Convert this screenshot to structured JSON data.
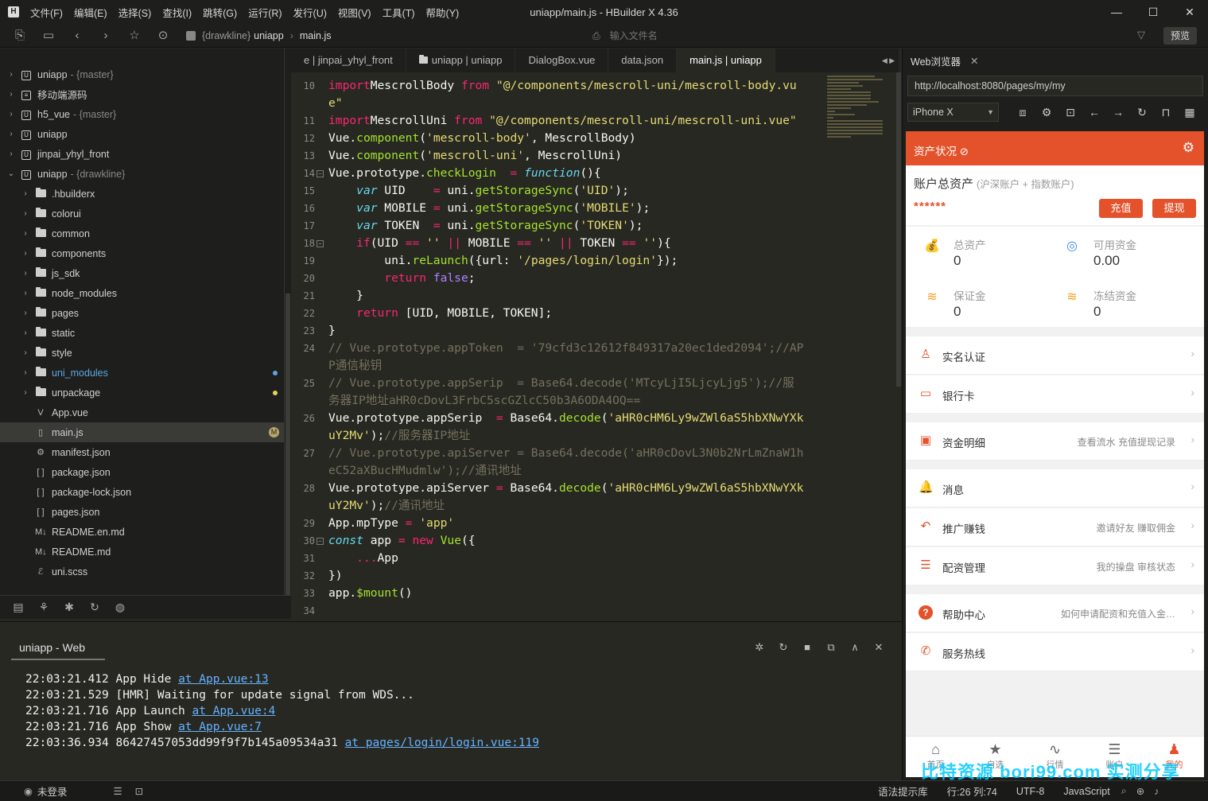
{
  "window": {
    "logo": "H",
    "title": "uniapp/main.js - HBuilder X 4.36",
    "menu": [
      "文件(F)",
      "编辑(E)",
      "选择(S)",
      "查找(I)",
      "跳转(G)",
      "运行(R)",
      "发行(U)",
      "视图(V)",
      "工具(T)",
      "帮助(Y)"
    ],
    "controls": {
      "minimize": "—",
      "maximize": "☐",
      "close": "✕"
    }
  },
  "toolbar": {
    "breadcrumb": [
      "{drawkline}",
      "uniapp",
      "main.js"
    ],
    "file_search_placeholder": "输入文件名",
    "preview_label": "预览"
  },
  "sidebar": {
    "items": [
      {
        "label": "uniapp",
        "branch": "- {master}",
        "type": "project",
        "expanded": false,
        "depth": 0
      },
      {
        "label": "移动端源码",
        "branch": "",
        "type": "project-alt",
        "expanded": false,
        "depth": 0
      },
      {
        "label": "h5_vue",
        "branch": "- {master}",
        "type": "project",
        "expanded": false,
        "depth": 0
      },
      {
        "label": "uniapp",
        "branch": "",
        "type": "project",
        "expanded": false,
        "depth": 0
      },
      {
        "label": "jinpai_yhyl_front",
        "branch": "",
        "type": "project",
        "expanded": false,
        "depth": 0
      },
      {
        "label": "uniapp",
        "branch": "- {drawkline}",
        "type": "project",
        "expanded": true,
        "depth": 0
      },
      {
        "label": ".hbuilderx",
        "type": "folder",
        "depth": 1
      },
      {
        "label": "colorui",
        "type": "folder",
        "depth": 1
      },
      {
        "label": "common",
        "type": "folder",
        "depth": 1
      },
      {
        "label": "components",
        "type": "folder",
        "depth": 1
      },
      {
        "label": "js_sdk",
        "type": "folder",
        "depth": 1
      },
      {
        "label": "node_modules",
        "type": "folder",
        "depth": 1
      },
      {
        "label": "pages",
        "type": "folder",
        "depth": 1
      },
      {
        "label": "static",
        "type": "folder",
        "depth": 1
      },
      {
        "label": "style",
        "type": "folder",
        "depth": 1
      },
      {
        "label": "uni_modules",
        "type": "folder",
        "depth": 1,
        "dot": "#5aa7e6",
        "highlight": true
      },
      {
        "label": "unpackage",
        "type": "folder",
        "depth": 1,
        "dot": "#e6d35a"
      },
      {
        "label": "App.vue",
        "type": "vue",
        "depth": 1
      },
      {
        "label": "main.js",
        "type": "js",
        "depth": 1,
        "selected": true,
        "badge": "M"
      },
      {
        "label": "manifest.json",
        "type": "manifest",
        "depth": 1
      },
      {
        "label": "package.json",
        "type": "json",
        "depth": 1
      },
      {
        "label": "package-lock.json",
        "type": "json",
        "depth": 1
      },
      {
        "label": "pages.json",
        "type": "json",
        "depth": 1
      },
      {
        "label": "README.en.md",
        "type": "md",
        "depth": 1
      },
      {
        "label": "README.md",
        "type": "md",
        "depth": 1
      },
      {
        "label": "uni.scss",
        "type": "scss",
        "depth": 1
      }
    ]
  },
  "editor": {
    "tabs": [
      {
        "label": "e | jinpai_yhyl_front",
        "active": false
      },
      {
        "label": "uniapp | uniapp",
        "active": false,
        "folder": true
      },
      {
        "label": "DialogBox.vue",
        "active": false
      },
      {
        "label": "data.json",
        "active": false
      },
      {
        "label": "main.js | uniapp",
        "active": true
      }
    ],
    "lines": [
      {
        "n": "10",
        "fold": false,
        "segs": [
          [
            "kw",
            "import"
          ],
          [
            "",
            "MescrollBody "
          ],
          [
            "kw",
            "from"
          ],
          [
            "",
            " "
          ],
          [
            "str",
            "\"@/components/mescroll-uni/mescroll-body.vu"
          ]
        ]
      },
      {
        "n": "",
        "fold": false,
        "segs": [
          [
            "str",
            "e\""
          ]
        ]
      },
      {
        "n": "11",
        "fold": false,
        "segs": [
          [
            "kw",
            "import"
          ],
          [
            "",
            "MescrollUni "
          ],
          [
            "kw",
            "from"
          ],
          [
            "",
            " "
          ],
          [
            "str",
            "\"@/components/mescroll-uni/mescroll-uni.vue\""
          ]
        ]
      },
      {
        "n": "12",
        "fold": false,
        "segs": [
          [
            "",
            "Vue."
          ],
          [
            "fn",
            "component"
          ],
          [
            "",
            "("
          ],
          [
            "str",
            "'mescroll-body'"
          ],
          [
            "",
            ", MescrollBody)"
          ]
        ]
      },
      {
        "n": "13",
        "fold": false,
        "segs": [
          [
            "",
            "Vue."
          ],
          [
            "fn",
            "component"
          ],
          [
            "",
            "("
          ],
          [
            "str",
            "'mescroll-uni'"
          ],
          [
            "",
            ", MescrollUni)"
          ]
        ]
      },
      {
        "n": "14",
        "fold": true,
        "segs": [
          [
            "",
            "Vue.prototype."
          ],
          [
            "fn",
            "checkLogin"
          ],
          [
            "",
            "  "
          ],
          [
            "kw",
            "="
          ],
          [
            "",
            " "
          ],
          [
            "it",
            "function"
          ],
          [
            "",
            "(){"
          ]
        ]
      },
      {
        "n": "15",
        "fold": false,
        "segs": [
          [
            "",
            "    "
          ],
          [
            "vr",
            "var"
          ],
          [
            "",
            " UID    "
          ],
          [
            "kw",
            "="
          ],
          [
            "",
            " uni."
          ],
          [
            "fn",
            "getStorageSync"
          ],
          [
            "",
            "("
          ],
          [
            "str",
            "'UID'"
          ],
          [
            "",
            ");"
          ]
        ]
      },
      {
        "n": "16",
        "fold": false,
        "segs": [
          [
            "",
            "    "
          ],
          [
            "vr",
            "var"
          ],
          [
            "",
            " MOBILE "
          ],
          [
            "kw",
            "="
          ],
          [
            "",
            " uni."
          ],
          [
            "fn",
            "getStorageSync"
          ],
          [
            "",
            "("
          ],
          [
            "str",
            "'MOBILE'"
          ],
          [
            "",
            ");"
          ]
        ]
      },
      {
        "n": "17",
        "fold": false,
        "segs": [
          [
            "",
            "    "
          ],
          [
            "vr",
            "var"
          ],
          [
            "",
            " TOKEN  "
          ],
          [
            "kw",
            "="
          ],
          [
            "",
            " uni."
          ],
          [
            "fn",
            "getStorageSync"
          ],
          [
            "",
            "("
          ],
          [
            "str",
            "'TOKEN'"
          ],
          [
            "",
            ");"
          ]
        ]
      },
      {
        "n": "18",
        "fold": true,
        "segs": [
          [
            "",
            "    "
          ],
          [
            "kw",
            "if"
          ],
          [
            "",
            "(UID "
          ],
          [
            "kw",
            "=="
          ],
          [
            "",
            " "
          ],
          [
            "str",
            "''"
          ],
          [
            "",
            " "
          ],
          [
            "kw",
            "||"
          ],
          [
            "",
            " MOBILE "
          ],
          [
            "kw",
            "=="
          ],
          [
            "",
            " "
          ],
          [
            "str",
            "''"
          ],
          [
            "",
            " "
          ],
          [
            "kw",
            "||"
          ],
          [
            "",
            " TOKEN "
          ],
          [
            "kw",
            "=="
          ],
          [
            "",
            " "
          ],
          [
            "str",
            "''"
          ],
          [
            "",
            "){"
          ]
        ]
      },
      {
        "n": "19",
        "fold": false,
        "segs": [
          [
            "",
            "        uni."
          ],
          [
            "fn",
            "reLaunch"
          ],
          [
            "",
            "({url: "
          ],
          [
            "str",
            "'/pages/login/login'"
          ],
          [
            "",
            "});"
          ]
        ]
      },
      {
        "n": "20",
        "fold": false,
        "segs": [
          [
            "",
            "        "
          ],
          [
            "kw",
            "return"
          ],
          [
            "",
            " "
          ],
          [
            "bl",
            "false"
          ],
          [
            "",
            ";"
          ]
        ]
      },
      {
        "n": "21",
        "fold": false,
        "segs": [
          [
            "",
            "    }"
          ]
        ]
      },
      {
        "n": "22",
        "fold": false,
        "segs": [
          [
            "",
            "    "
          ],
          [
            "kw",
            "return"
          ],
          [
            "",
            " [UID, MOBILE, TOKEN];"
          ]
        ]
      },
      {
        "n": "23",
        "fold": false,
        "segs": [
          [
            "",
            "}"
          ]
        ]
      },
      {
        "n": "24",
        "fold": false,
        "segs": [
          [
            "cm",
            "// Vue.prototype.appToken  = '79cfd3c12612f849317a20ec1ded2094';//AP"
          ]
        ]
      },
      {
        "n": "",
        "fold": false,
        "segs": [
          [
            "cm",
            "P通信秘钥"
          ]
        ]
      },
      {
        "n": "25",
        "fold": false,
        "segs": [
          [
            "cm",
            "// Vue.prototype.appSerip  = Base64.decode('MTcyLjI5LjcyLjg5');//服"
          ]
        ]
      },
      {
        "n": "",
        "fold": false,
        "segs": [
          [
            "cm",
            "务器IP地址aHR0cDovL3FrbC5scGZlcC50b3A6ODA4OQ=="
          ]
        ]
      },
      {
        "n": "26",
        "fold": false,
        "segs": [
          [
            "",
            "Vue.prototype.appSerip  "
          ],
          [
            "kw",
            "="
          ],
          [
            "",
            " Base64."
          ],
          [
            "fn",
            "decode"
          ],
          [
            "",
            "("
          ],
          [
            "str",
            "'aHR0cHM6Ly9wZWl6aS5hbXNwYXk"
          ]
        ]
      },
      {
        "n": "",
        "fold": false,
        "segs": [
          [
            "str",
            "uY2Mv'"
          ],
          [
            "",
            ");"
          ],
          [
            "cm",
            "//服务器IP地址"
          ]
        ]
      },
      {
        "n": "27",
        "fold": false,
        "segs": [
          [
            "cm",
            "// Vue.prototype.apiServer = Base64.decode('aHR0cDovL3N0b2NrLmZnaW1h"
          ]
        ]
      },
      {
        "n": "",
        "fold": false,
        "segs": [
          [
            "cm",
            "eC52aXBucHMudmlw');//通讯地址"
          ]
        ]
      },
      {
        "n": "28",
        "fold": false,
        "segs": [
          [
            "",
            "Vue.prototype.apiServer "
          ],
          [
            "kw",
            "="
          ],
          [
            "",
            " Base64."
          ],
          [
            "fn",
            "decode"
          ],
          [
            "",
            "("
          ],
          [
            "str",
            "'aHR0cHM6Ly9wZWl6aS5hbXNwYXk"
          ]
        ]
      },
      {
        "n": "",
        "fold": false,
        "segs": [
          [
            "str",
            "uY2Mv'"
          ],
          [
            "",
            ");"
          ],
          [
            "cm",
            "//通讯地址"
          ]
        ]
      },
      {
        "n": "29",
        "fold": false,
        "segs": [
          [
            "",
            "App.mpType "
          ],
          [
            "kw",
            "="
          ],
          [
            "",
            " "
          ],
          [
            "str",
            "'app'"
          ]
        ]
      },
      {
        "n": "30",
        "fold": true,
        "segs": [
          [
            "it",
            "const"
          ],
          [
            "",
            " app "
          ],
          [
            "kw",
            "="
          ],
          [
            "",
            " "
          ],
          [
            "kw",
            "new"
          ],
          [
            "",
            " "
          ],
          [
            "fn",
            "Vue"
          ],
          [
            "",
            "({"
          ]
        ]
      },
      {
        "n": "31",
        "fold": false,
        "segs": [
          [
            "",
            "    "
          ],
          [
            "kw",
            "..."
          ],
          [
            "",
            "App"
          ]
        ]
      },
      {
        "n": "32",
        "fold": false,
        "segs": [
          [
            "",
            "})"
          ]
        ]
      },
      {
        "n": "33",
        "fold": false,
        "segs": [
          [
            "",
            "app."
          ],
          [
            "fn",
            "$mount"
          ],
          [
            "",
            "()"
          ]
        ]
      },
      {
        "n": "34",
        "fold": false,
        "segs": [
          [
            "",
            ""
          ]
        ]
      }
    ]
  },
  "console": {
    "title": "uniapp - Web",
    "logs": [
      {
        "text": "22:03:21.412 App Hide ",
        "link": "at App.vue:13"
      },
      {
        "text": "22:03:21.529 [HMR] Waiting for update signal from WDS...",
        "link": ""
      },
      {
        "text": "22:03:21.716 App Launch ",
        "link": "at App.vue:4"
      },
      {
        "text": "22:03:21.716 App Show ",
        "link": "at App.vue:7"
      },
      {
        "text": "22:03:36.934 86427457053dd99f9f7b145a09534a31 ",
        "link": "at pages/login/login.vue:119"
      }
    ]
  },
  "statusbar": {
    "login": "未登录",
    "syntax_hint": "语法提示库",
    "position": "行:26  列:74",
    "encoding": "UTF-8",
    "language": "JavaScript"
  },
  "browser": {
    "tab_label": "Web浏览器",
    "url": "http://localhost:8080/pages/my/my",
    "device": "iPhone X"
  },
  "phone": {
    "header_title": "资产状况",
    "account_title": "账户总资产",
    "account_sub": "(沪深账户 + 指数账户)",
    "masked": "******",
    "recharge": "充值",
    "withdraw": "提现",
    "stats": [
      {
        "label": "总资产",
        "value": "0",
        "icon": "money-bag-icon"
      },
      {
        "label": "可用资金",
        "value": "0.00",
        "icon": "target-icon"
      },
      {
        "label": "保证金",
        "value": "0",
        "icon": "coins-icon"
      },
      {
        "label": "冻结资金",
        "value": "0",
        "icon": "coins-frozen-icon"
      }
    ],
    "menu": [
      {
        "label": "实名认证",
        "right": "",
        "icon": "user-icon",
        "color": "#e4522b"
      },
      {
        "label": "银行卡",
        "right": "",
        "icon": "card-icon",
        "color": "#e4522b"
      },
      {
        "label": "资金明细",
        "right": "查看流水 充值提现记录",
        "icon": "wallet-icon",
        "color": "#e4522b"
      },
      {
        "label": "消息",
        "right": "",
        "icon": "bell-icon",
        "color": "#e4522b"
      },
      {
        "label": "推广赚钱",
        "right": "邀请好友 赚取佣金",
        "icon": "share-icon",
        "color": "#e4522b"
      },
      {
        "label": "配资管理",
        "right": "我的操盘 审核状态",
        "icon": "sliders-icon",
        "color": "#e4522b"
      },
      {
        "label": "帮助中心",
        "right": "如何申请配资和充值入金…",
        "icon": "help-icon",
        "color": "#e4522b"
      },
      {
        "label": "服务热线",
        "right": "",
        "icon": "phone-icon",
        "color": "#e4522b"
      }
    ],
    "tabs": [
      {
        "label": "首页",
        "icon": "home-icon"
      },
      {
        "label": "自选",
        "icon": "star-icon"
      },
      {
        "label": "行情",
        "icon": "pulse-icon"
      },
      {
        "label": "账户",
        "icon": "database-icon"
      },
      {
        "label": "我的",
        "icon": "person-icon",
        "active": true
      }
    ]
  },
  "watermark": "比特资源 bori99.com 实测分享"
}
